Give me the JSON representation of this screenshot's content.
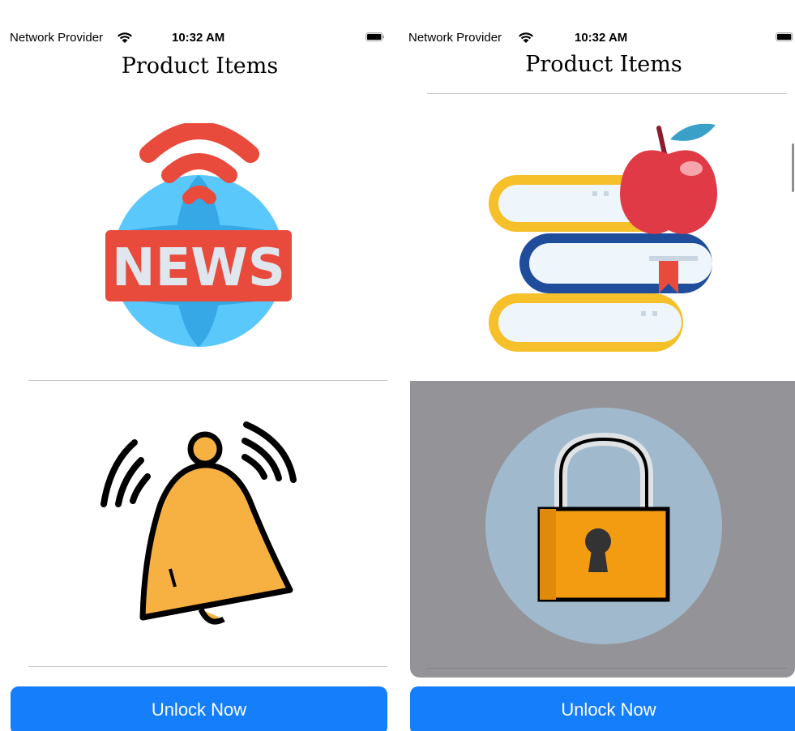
{
  "status": {
    "carrier": "Network Provider",
    "time": "10:32 AM",
    "icons": [
      "wifi-icon",
      "battery-icon"
    ]
  },
  "screens": [
    {
      "title": "Product Items",
      "items": [
        {
          "icon": "news-globe-icon"
        },
        {
          "icon": "ringing-bell-icon"
        }
      ],
      "button_label": "Unlock Now"
    },
    {
      "title": "Product Items",
      "items": [
        {
          "icon": "books-apple-icon"
        },
        {
          "icon": "padlock-icon",
          "selected": true
        }
      ],
      "button_label": "Unlock Now"
    }
  ],
  "colors": {
    "button": "#147efb",
    "selected_row": "#939398",
    "separator": "#c8c8cc"
  }
}
